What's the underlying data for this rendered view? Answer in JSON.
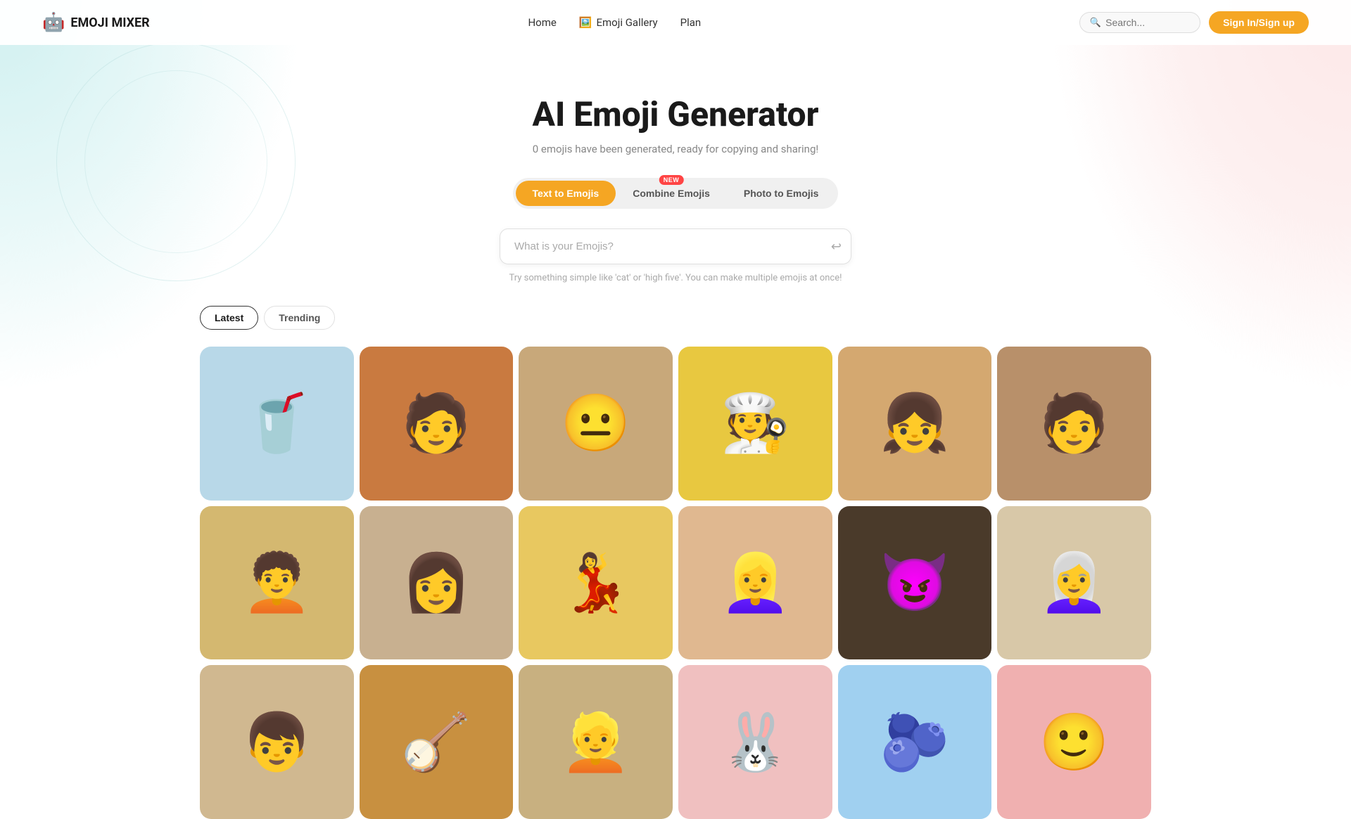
{
  "nav": {
    "logo_icon": "🤖",
    "logo_text": "EMOJI MIXER",
    "links": [
      {
        "id": "home",
        "label": "Home",
        "icon": ""
      },
      {
        "id": "gallery",
        "label": "Emoji Gallery",
        "icon": "🖼️"
      },
      {
        "id": "plan",
        "label": "Plan",
        "icon": ""
      }
    ],
    "search_placeholder": "Search...",
    "signin_label": "Sign In/Sign up"
  },
  "hero": {
    "title": "AI Emoji Generator",
    "subtitle": "0 emojis have been generated, ready for copying and sharing!"
  },
  "tabs": [
    {
      "id": "text",
      "label": "Text to Emojis",
      "active": true,
      "new_badge": false
    },
    {
      "id": "combine",
      "label": "Combine Emojis",
      "active": false,
      "new_badge": true
    },
    {
      "id": "photo",
      "label": "Photo to Emojis",
      "active": false,
      "new_badge": false
    }
  ],
  "new_badge_text": "NEW",
  "input": {
    "placeholder": "What is your Emojis?",
    "hint": "Try something simple like 'cat' or 'high five'. You can make multiple emojis at once!"
  },
  "filter_tabs": [
    {
      "id": "latest",
      "label": "Latest",
      "active": true
    },
    {
      "id": "trending",
      "label": "Trending",
      "active": false
    }
  ],
  "emoji_cards": [
    {
      "id": "card-1",
      "bg": "card-bg-blue",
      "emoji": "🥤"
    },
    {
      "id": "card-2",
      "bg": "card-bg-orange",
      "emoji": "🧑"
    },
    {
      "id": "card-3",
      "bg": "card-bg-tan",
      "emoji": "😐"
    },
    {
      "id": "card-4",
      "bg": "card-bg-yellow",
      "emoji": "🧑‍🍳"
    },
    {
      "id": "card-5",
      "bg": "card-bg-skin",
      "emoji": "👧"
    },
    {
      "id": "card-6",
      "bg": "card-bg-brown",
      "emoji": "🧑"
    },
    {
      "id": "card-7",
      "bg": "card-bg-warm",
      "emoji": "🧑‍🦱"
    },
    {
      "id": "card-8",
      "bg": "card-bg-gray",
      "emoji": "👩"
    },
    {
      "id": "card-9",
      "bg": "card-bg-gold",
      "emoji": "💃"
    },
    {
      "id": "card-10",
      "bg": "card-bg-peachy",
      "emoji": "👱‍♀️"
    },
    {
      "id": "card-11",
      "bg": "card-bg-dark",
      "emoji": "😈"
    },
    {
      "id": "card-12",
      "bg": "card-bg-light",
      "emoji": "👩‍🦳"
    },
    {
      "id": "card-13",
      "bg": "card-bg-beige",
      "emoji": "👦"
    },
    {
      "id": "card-14",
      "bg": "card-bg-amber",
      "emoji": "🪕"
    },
    {
      "id": "card-15",
      "bg": "card-bg-sand",
      "emoji": "👱"
    },
    {
      "id": "card-16",
      "bg": "card-bg-pink",
      "emoji": "🐰"
    },
    {
      "id": "card-17",
      "bg": "card-bg-sky",
      "emoji": "🫐"
    },
    {
      "id": "card-18",
      "bg": "card-bg-rose",
      "emoji": "🙂"
    }
  ],
  "colors": {
    "accent": "#f5a623",
    "active_tab_bg": "#f5a623",
    "new_badge_bg": "#ff4444"
  }
}
